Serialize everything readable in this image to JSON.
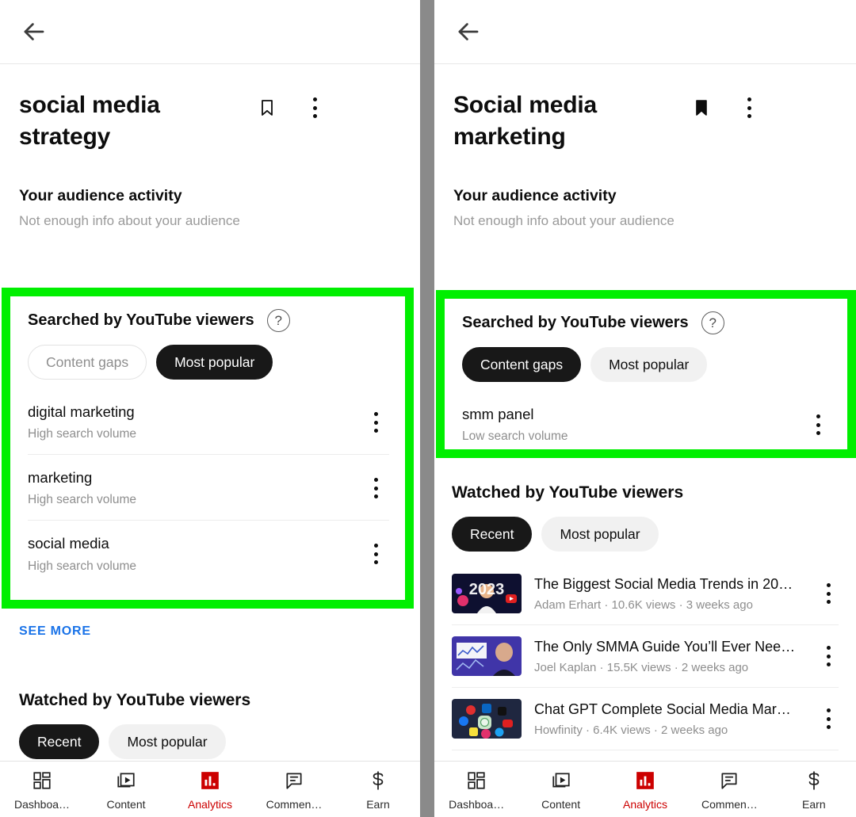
{
  "left": {
    "back_icon": "arrow-left-icon",
    "title": "social media strategy",
    "bookmark_state": "outline",
    "audience": {
      "heading": "Your audience activity",
      "text": "Not enough info about your audience"
    },
    "searched": {
      "title": "Searched by YouTube viewers",
      "help_icon": "?",
      "tabs": [
        {
          "label": "Content gaps",
          "state": "outline"
        },
        {
          "label": "Most popular",
          "state": "active"
        }
      ],
      "rows": [
        {
          "name": "digital marketing",
          "volume": "High search volume"
        },
        {
          "name": "marketing",
          "volume": "High search volume"
        },
        {
          "name": "social media",
          "volume": "High search volume"
        }
      ]
    },
    "see_more": "SEE MORE",
    "watched": {
      "title": "Watched by YouTube viewers",
      "tabs": [
        {
          "label": "Recent",
          "state": "active"
        },
        {
          "label": "Most popular",
          "state": "muted"
        }
      ]
    },
    "nav": [
      {
        "label": "Dashboa…",
        "icon": "dashboard-icon",
        "active": false
      },
      {
        "label": "Content",
        "icon": "content-icon",
        "active": false
      },
      {
        "label": "Analytics",
        "icon": "analytics-icon",
        "active": true
      },
      {
        "label": "Commen…",
        "icon": "comments-icon",
        "active": false
      },
      {
        "label": "Earn",
        "icon": "earn-icon",
        "active": false
      }
    ]
  },
  "right": {
    "back_icon": "arrow-left-icon",
    "title": "Social media marketing",
    "bookmark_state": "filled",
    "audience": {
      "heading": "Your audience activity",
      "text": "Not enough info about your audience"
    },
    "searched": {
      "title": "Searched by YouTube viewers",
      "help_icon": "?",
      "tabs": [
        {
          "label": "Content gaps",
          "state": "active"
        },
        {
          "label": "Most popular",
          "state": "muted"
        }
      ],
      "rows": [
        {
          "name": "smm panel",
          "volume": "Low search volume"
        }
      ]
    },
    "watched": {
      "title": "Watched by YouTube viewers",
      "tabs": [
        {
          "label": "Recent",
          "state": "active"
        },
        {
          "label": "Most popular",
          "state": "muted"
        }
      ],
      "videos": [
        {
          "title": "The Biggest Social Media Trends in 20…",
          "sub": "Adam Erhart · 10.6K views · 3 weeks ago",
          "thumb": "thumb-2023"
        },
        {
          "title": "The Only SMMA Guide You’ll Ever Nee…",
          "sub": "Joel Kaplan · 15.5K views · 2 weeks ago",
          "thumb": "thumb-chart"
        },
        {
          "title": "Chat GPT Complete Social Media Mar…",
          "sub": "Howfinity · 6.4K views · 2 weeks ago",
          "thumb": "thumb-icons"
        }
      ]
    },
    "nav": [
      {
        "label": "Dashboa…",
        "icon": "dashboard-icon",
        "active": false
      },
      {
        "label": "Content",
        "icon": "content-icon",
        "active": false
      },
      {
        "label": "Analytics",
        "icon": "analytics-icon",
        "active": true
      },
      {
        "label": "Commen…",
        "icon": "comments-icon",
        "active": false
      },
      {
        "label": "Earn",
        "icon": "earn-icon",
        "active": false
      }
    ]
  },
  "colors": {
    "highlight": "#00ef00",
    "accent_red": "#cc0000",
    "link_blue": "#1a73e8",
    "divider_gray": "#8a8a8a"
  }
}
